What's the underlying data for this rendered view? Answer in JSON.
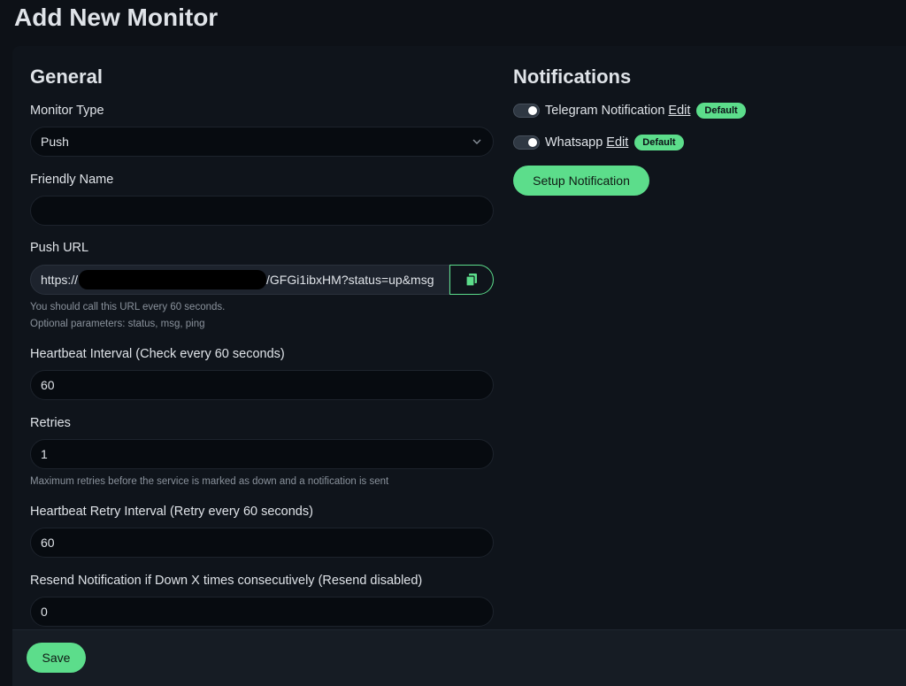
{
  "page": {
    "title": "Add New Monitor"
  },
  "general": {
    "heading": "General",
    "monitor_type": {
      "label": "Monitor Type",
      "value": "Push"
    },
    "friendly_name": {
      "label": "Friendly Name",
      "value": ""
    },
    "push_url": {
      "label": "Push URL",
      "value_prefix": "https://",
      "value_suffix": "/GFGi1ibxHM?status=up&msg",
      "help_line1": "You should call this URL every 60 seconds.",
      "help_line2": "Optional parameters: status, msg, ping"
    },
    "heartbeat_interval": {
      "label": "Heartbeat Interval (Check every 60 seconds)",
      "value": "60"
    },
    "retries": {
      "label": "Retries",
      "value": "1",
      "help": "Maximum retries before the service is marked as down and a notification is sent"
    },
    "retry_interval": {
      "label": "Heartbeat Retry Interval (Retry every 60 seconds)",
      "value": "60"
    },
    "resend": {
      "label": "Resend Notification if Down X times consecutively (Resend disabled)",
      "value": "0"
    }
  },
  "notifications": {
    "heading": "Notifications",
    "items": [
      {
        "name": "Telegram Notification",
        "edit": "Edit",
        "badge": "Default",
        "enabled": true
      },
      {
        "name": "Whatsapp",
        "edit": "Edit",
        "badge": "Default",
        "enabled": true
      }
    ],
    "setup_label": "Setup Notification"
  },
  "footer": {
    "save_label": "Save"
  },
  "colors": {
    "accent": "#5cdd8b",
    "background": "#0d1117",
    "input": "#070b10"
  },
  "icons": {
    "copy": "copy-icon",
    "chevron": "chevron-down-icon"
  }
}
